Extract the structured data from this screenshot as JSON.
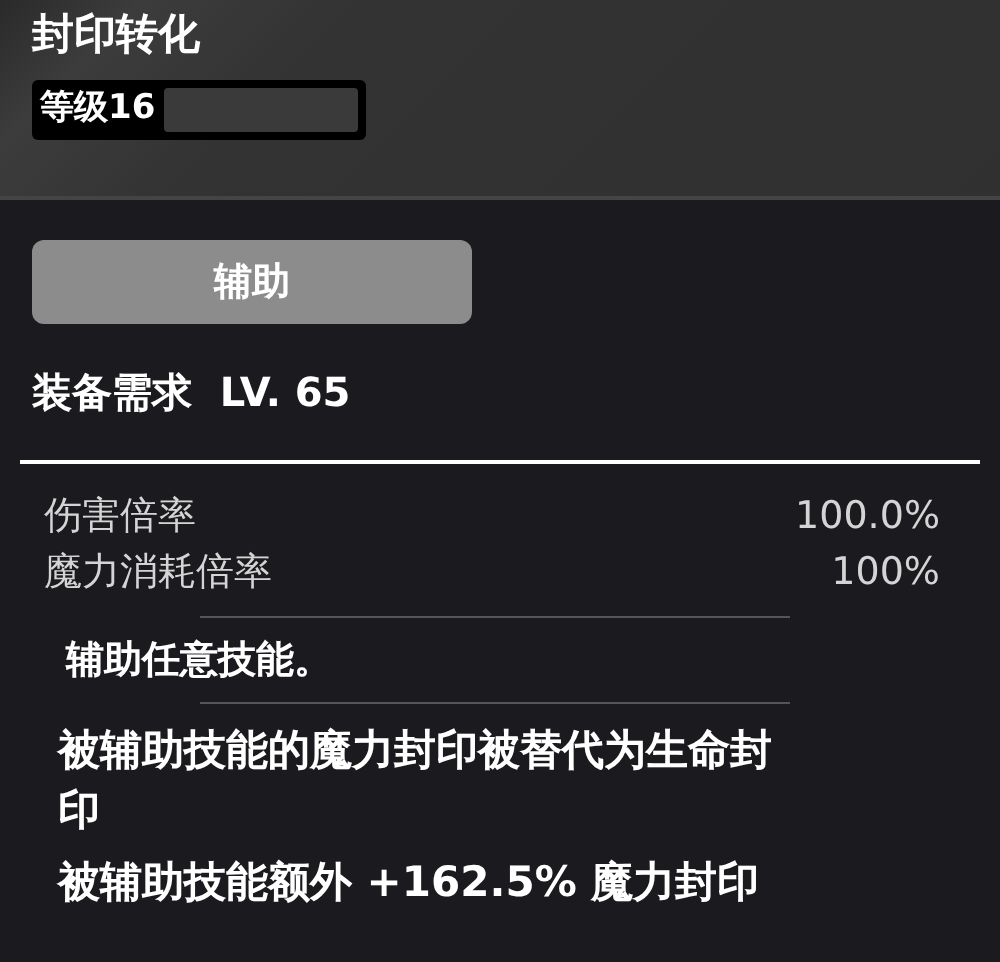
{
  "title": "封印转化",
  "gem_level": {
    "label": "等级16"
  },
  "tag": "辅助",
  "requirement": "装备需求  LV. 65",
  "stats": [
    {
      "label": "伤害倍率",
      "value": "100.0%"
    },
    {
      "label": "魔力消耗倍率",
      "value": "100%"
    }
  ],
  "description": "辅助任意技能。",
  "effects": [
    "被辅助技能的魔力封印被替代为生命封印",
    "被辅助技能额外 +162.5% 魔力封印"
  ]
}
